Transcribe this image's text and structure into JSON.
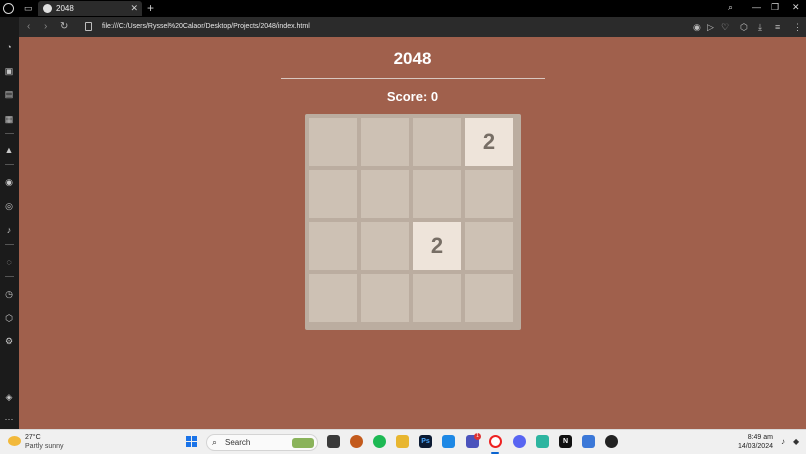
{
  "browser": {
    "tab_title": "2048",
    "tab_close": "✕",
    "new_tab": "+",
    "url": "file:///C:/Users/Ryssel%20Calaor/Desktop/Projects/2048/index.html"
  },
  "game": {
    "title": "2048",
    "score_label": "Score:",
    "score": "0",
    "grid": [
      [
        "",
        "",
        "",
        "2"
      ],
      [
        "",
        "",
        "",
        ""
      ],
      [
        "",
        "",
        "2",
        ""
      ],
      [
        "",
        "",
        "",
        ""
      ]
    ]
  },
  "taskbar": {
    "weather_temp": "27°C",
    "weather_desc": "Partly sunny",
    "search_label": "Search",
    "time": "8:49 am",
    "date": "14/03/2024",
    "teams_badge": "1"
  },
  "colors": {
    "page_background": "#a0604c",
    "board": "#bbada0",
    "empty_cell": "#cdc1b4",
    "tile_2": "#eee4da",
    "tile_text": "#776e65"
  }
}
